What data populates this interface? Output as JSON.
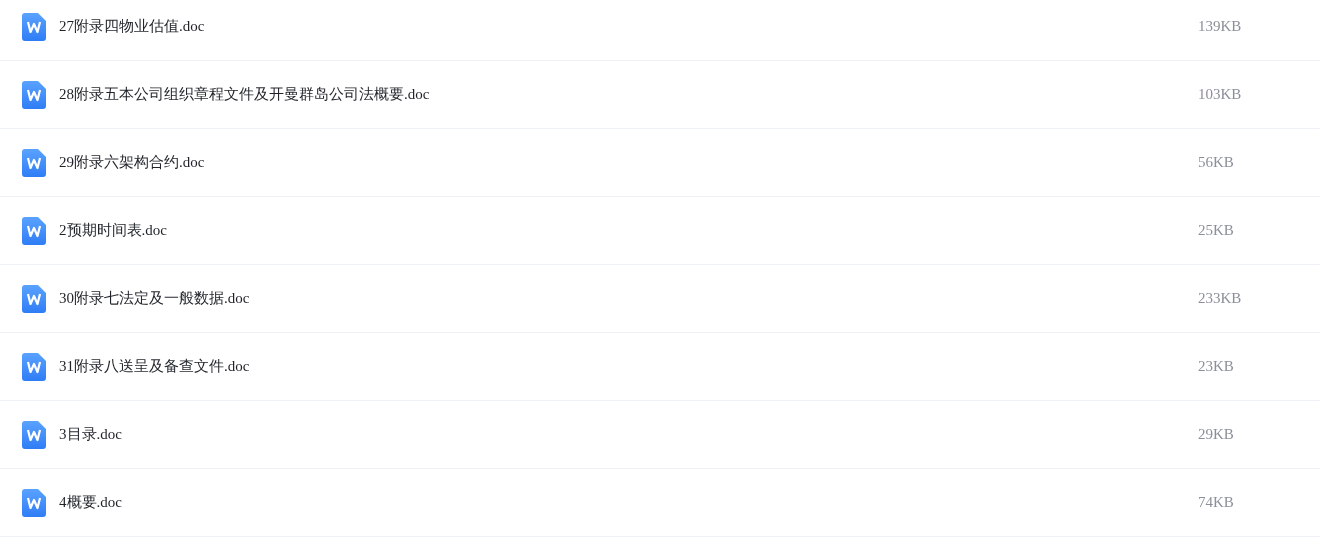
{
  "files": [
    {
      "name": "27附录四物业估值.doc",
      "size": "139KB"
    },
    {
      "name": "28附录五本公司组织章程文件及开曼群岛公司法概要.doc",
      "size": "103KB"
    },
    {
      "name": "29附录六架构合约.doc",
      "size": "56KB"
    },
    {
      "name": "2预期时间表.doc",
      "size": "25KB"
    },
    {
      "name": "30附录七法定及一般数据.doc",
      "size": "233KB"
    },
    {
      "name": "31附录八送呈及备查文件.doc",
      "size": "23KB"
    },
    {
      "name": "3目录.doc",
      "size": "29KB"
    },
    {
      "name": "4概要.doc",
      "size": "74KB"
    }
  ]
}
